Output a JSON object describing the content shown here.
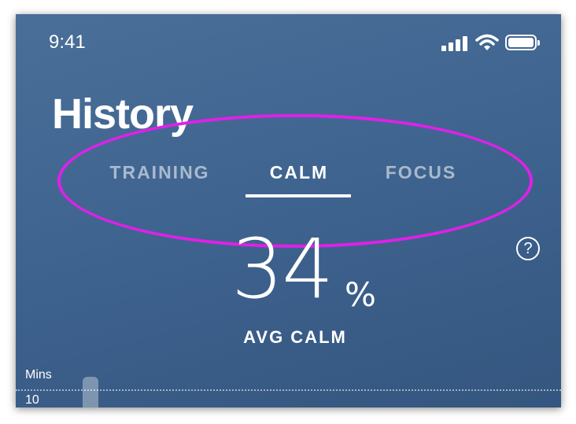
{
  "status_bar": {
    "time": "9:41",
    "icons": [
      "signal-icon",
      "wifi-icon",
      "battery-icon"
    ]
  },
  "header": {
    "title": "History"
  },
  "tabs": [
    {
      "label": "TRAINING",
      "active": false
    },
    {
      "label": "CALM",
      "active": true
    },
    {
      "label": "FOCUS",
      "active": false
    }
  ],
  "summary": {
    "value": "34",
    "unit": "%",
    "label": "AVG CALM",
    "help_icon": "question-icon",
    "help_glyph": "?"
  },
  "chart": {
    "y_unit": "Mins",
    "y_tick": "10"
  },
  "colors": {
    "annotation": "#e020e8",
    "background_top": "#4a6f98",
    "background_bottom": "#34567f"
  }
}
